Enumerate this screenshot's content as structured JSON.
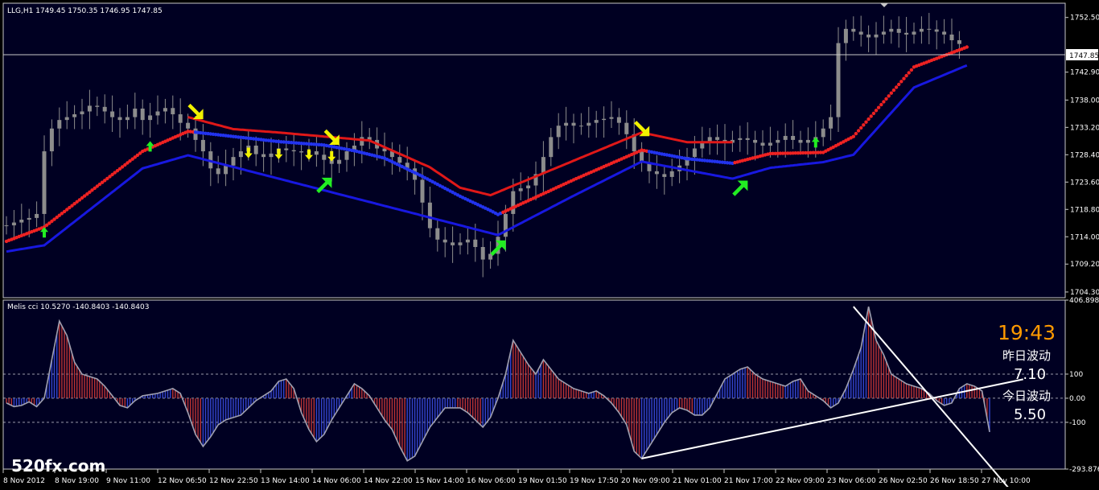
{
  "colors": {
    "background": "#000000",
    "plot_bg": "#000022",
    "frame": "#c8c8c8",
    "candles": "#8c8c8c",
    "band_up": "#1818e0",
    "band_down": "#e01818",
    "dots_up": "#2233ee",
    "dots_down": "#ee2222",
    "arrow_up": "#22ee22",
    "arrow_down": "#f2f200",
    "hist_up": "#3344cc",
    "hist_down": "#bb3333",
    "cci_line": "#a0a0b0",
    "trend_line": "#ffffff",
    "clock": "#ff9900",
    "text": "#ffffff"
  },
  "main_header": "LLG,H1  1749.45 1750.35 1746.95 1747.85",
  "current_price": "1747.85",
  "cci_header": "Melis cci 10.5270 -140.8403 -140.8403",
  "info_panel": {
    "clock": "19:43",
    "prev_label": "昨日波动",
    "prev_value": "7.10",
    "today_label": "今日波动",
    "today_value": "5.50"
  },
  "watermark": "520fx.com",
  "chart_data": [
    {
      "type": "line",
      "title": "LLG,H1",
      "y_tick_labels": [
        "1752.50",
        "1747.85",
        "1742.90",
        "1738.00",
        "1733.20",
        "1728.40",
        "1723.60",
        "1718.80",
        "1714.00",
        "1709.20",
        "1704.30"
      ],
      "ylim": [
        1703.3,
        1755.0
      ],
      "x_tick_labels": [
        "8 Nov 2012",
        "8 Nov 19:00",
        "9 Nov 11:00",
        "12 Nov 06:50",
        "12 Nov 22:50",
        "13 Nov 14:00",
        "14 Nov 06:00",
        "14 Nov 22:00",
        "15 Nov 14:00",
        "16 Nov 06:00",
        "19 Nov 01:50",
        "19 Nov 17:50",
        "20 Nov 09:00",
        "21 Nov 01:00",
        "21 Nov 17:00",
        "22 Nov 09:00",
        "23 Nov 06:00",
        "26 Nov 02:50",
        "26 Nov 18:50",
        "27 Nov 10:00"
      ],
      "last_close": 1747.85,
      "price_close_estimate": [
        1716.0,
        1716.5,
        1717.0,
        1717.3,
        1718.0,
        1729.0,
        1733.0,
        1734.5,
        1735.0,
        1735.5,
        1736.0,
        1737.0,
        1736.8,
        1736.0,
        1735.0,
        1734.5,
        1735.0,
        1736.5,
        1734.5,
        1735.3,
        1736.0,
        1736.6,
        1735.5,
        1734.0,
        1733.0,
        1731.0,
        1729.0,
        1726.0,
        1725.0,
        1726.5,
        1728.0,
        1729.0,
        1730.0,
        1728.5,
        1728.0,
        1728.6,
        1729.5,
        1729.2,
        1729.0,
        1728.8,
        1729.0,
        1728.4,
        1727.5,
        1726.8,
        1727.5,
        1729.0,
        1730.0,
        1731.5,
        1731.0,
        1729.5,
        1729.0,
        1728.0,
        1727.0,
        1726.0,
        1724.0,
        1720.0,
        1715.5,
        1713.5,
        1713.0,
        1712.5,
        1713.0,
        1713.5,
        1712.2,
        1710.0,
        1711.0,
        1714.0,
        1718.0,
        1722.0,
        1722.5,
        1723.0,
        1725.0,
        1728.0,
        1731.5,
        1733.5,
        1734.0,
        1733.5,
        1733.5,
        1734.0,
        1734.5,
        1734.7,
        1735.0,
        1734.0,
        1732.0,
        1729.0,
        1727.0,
        1725.5,
        1725.0,
        1724.5,
        1725.5,
        1726.5,
        1728.0,
        1729.5,
        1730.5,
        1731.5,
        1731.0,
        1730.5,
        1731.0,
        1731.3,
        1731.0,
        1730.5,
        1730.0,
        1730.5,
        1731.0,
        1731.7,
        1731.0,
        1730.5,
        1731.0,
        1731.5,
        1733.0,
        1735.0,
        1748.0,
        1750.5,
        1750.0,
        1749.5,
        1749.0,
        1749.5,
        1750.0,
        1750.5,
        1749.8,
        1749.5,
        1750.0,
        1750.5,
        1750.4,
        1750.0,
        1749.5,
        1748.5,
        1747.85
      ],
      "upper_band_estimate": [
        {
          "x": 0,
          "y": 1713.2
        },
        {
          "x": 5,
          "y": 1715.7
        },
        {
          "x": 18,
          "y": 1729.0
        },
        {
          "x": 24,
          "y": 1732.5
        },
        {
          "x": 30,
          "y": 1731.6
        },
        {
          "x": 36,
          "y": 1730.7
        },
        {
          "x": 42,
          "y": 1730.1
        },
        {
          "x": 46,
          "y": 1729.1
        },
        {
          "x": 50,
          "y": 1727.8
        },
        {
          "x": 55,
          "y": 1724.6
        },
        {
          "x": 60,
          "y": 1721.1
        },
        {
          "x": 64,
          "y": 1718.6
        },
        {
          "x": 65,
          "y": 1717.9
        },
        {
          "x": 75,
          "y": 1724.0
        },
        {
          "x": 84,
          "y": 1729.2
        },
        {
          "x": 90,
          "y": 1727.7
        },
        {
          "x": 96,
          "y": 1726.9
        },
        {
          "x": 101,
          "y": 1728.6
        },
        {
          "x": 108,
          "y": 1728.8
        },
        {
          "x": 112,
          "y": 1731.6
        },
        {
          "x": 120,
          "y": 1743.8
        },
        {
          "x": 127,
          "y": 1747.3
        }
      ],
      "lower_band_estimate": [
        {
          "x": 0,
          "y": 1711.4
        },
        {
          "x": 5,
          "y": 1712.5
        },
        {
          "x": 18,
          "y": 1726.0
        },
        {
          "x": 24,
          "y": 1728.3
        },
        {
          "x": 65,
          "y": 1714.3
        },
        {
          "x": 75,
          "y": 1721.2
        },
        {
          "x": 84,
          "y": 1727.2
        },
        {
          "x": 96,
          "y": 1724.2
        },
        {
          "x": 101,
          "y": 1726.1
        },
        {
          "x": 108,
          "y": 1727.1
        },
        {
          "x": 112,
          "y": 1728.4
        },
        {
          "x": 120,
          "y": 1740.2
        },
        {
          "x": 127,
          "y": 1744.1
        }
      ],
      "upper_resistance_estimate": [
        {
          "x": 24,
          "y": 1735.0
        },
        {
          "x": 30,
          "y": 1732.9
        },
        {
          "x": 36,
          "y": 1732.3
        },
        {
          "x": 42,
          "y": 1731.6
        },
        {
          "x": 48,
          "y": 1730.9
        },
        {
          "x": 56,
          "y": 1726.2
        },
        {
          "x": 60,
          "y": 1722.6
        },
        {
          "x": 64,
          "y": 1721.3
        },
        {
          "x": 84,
          "y": 1732.3
        },
        {
          "x": 90,
          "y": 1730.6
        },
        {
          "x": 96,
          "y": 1730.6
        }
      ],
      "signal_arrows": [
        {
          "x": 5,
          "y": 1714.7,
          "dir": "up",
          "kind": "small"
        },
        {
          "x": 19,
          "y": 1729.8,
          "dir": "up",
          "kind": "small"
        },
        {
          "x": 25,
          "y": 1736.0,
          "dir": "down",
          "kind": "large"
        },
        {
          "x": 32,
          "y": 1728.8,
          "dir": "down",
          "kind": "small"
        },
        {
          "x": 36,
          "y": 1728.6,
          "dir": "down",
          "kind": "small"
        },
        {
          "x": 40,
          "y": 1728.5,
          "dir": "down",
          "kind": "small"
        },
        {
          "x": 42,
          "y": 1723.0,
          "dir": "up",
          "kind": "large"
        },
        {
          "x": 43,
          "y": 1728.2,
          "dir": "down",
          "kind": "small"
        },
        {
          "x": 43,
          "y": 1731.5,
          "dir": "down",
          "kind": "large"
        },
        {
          "x": 65,
          "y": 1712.0,
          "dir": "up",
          "kind": "large"
        },
        {
          "x": 84,
          "y": 1733.0,
          "dir": "down",
          "kind": "large"
        },
        {
          "x": 97,
          "y": 1722.5,
          "dir": "up",
          "kind": "large"
        },
        {
          "x": 107,
          "y": 1730.5,
          "dir": "up",
          "kind": "small"
        }
      ]
    },
    {
      "type": "area",
      "title": "Melis cci",
      "y_tick_labels": [
        "406.8986",
        "100",
        "0.00",
        "-100",
        "-293.876"
      ],
      "ylim": [
        -293.876,
        406.8986
      ],
      "values_estimate": [
        -20,
        -35,
        -30,
        -15,
        -35,
        0,
        160,
        320,
        260,
        150,
        100,
        90,
        80,
        50,
        10,
        -30,
        -40,
        -10,
        10,
        15,
        20,
        30,
        40,
        20,
        -60,
        -150,
        -200,
        -160,
        -110,
        -90,
        -80,
        -70,
        -40,
        -10,
        10,
        30,
        70,
        80,
        40,
        -60,
        -130,
        -180,
        -150,
        -90,
        -40,
        10,
        60,
        40,
        10,
        -40,
        -90,
        -130,
        -200,
        -260,
        -240,
        -180,
        -120,
        -80,
        -40,
        -40,
        -40,
        -60,
        -90,
        -120,
        -80,
        0,
        100,
        240,
        190,
        140,
        100,
        160,
        120,
        80,
        60,
        40,
        30,
        20,
        30,
        10,
        -20,
        -60,
        -110,
        -220,
        -250,
        -200,
        -150,
        -100,
        -60,
        -40,
        -50,
        -70,
        -70,
        -40,
        20,
        80,
        100,
        120,
        130,
        100,
        80,
        70,
        60,
        50,
        70,
        80,
        30,
        10,
        -10,
        -40,
        -20,
        40,
        120,
        210,
        380,
        240,
        180,
        100,
        80,
        60,
        50,
        40,
        20,
        -10,
        -30,
        -20,
        40,
        60,
        50,
        30,
        -140
      ],
      "trend_lines": [
        {
          "from": {
            "x": 84,
            "y": -250
          },
          "to": {
            "x": 127,
            "y": 30
          }
        },
        {
          "from": {
            "x": 112,
            "y": 380
          },
          "to": {
            "x": 127,
            "y": -170
          }
        }
      ]
    }
  ]
}
